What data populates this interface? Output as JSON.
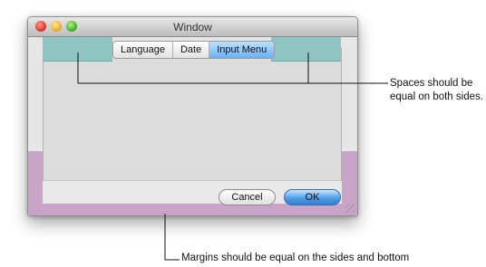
{
  "window": {
    "title": "Window",
    "tabs": [
      {
        "label": "Language",
        "selected": false
      },
      {
        "label": "Date",
        "selected": false
      },
      {
        "label": "Input Menu",
        "selected": true
      }
    ],
    "buttons": {
      "cancel_label": "Cancel",
      "ok_label": "OK"
    }
  },
  "annotations": {
    "spaces_note": "Spaces should be equal on both sides.",
    "margins_note": "Margins should be equal on the sides and bottom"
  },
  "colors": {
    "space_marker": "#8ec5c3",
    "margin_band": "#c9a3c8",
    "selected_tab": "#6ab0f2"
  }
}
